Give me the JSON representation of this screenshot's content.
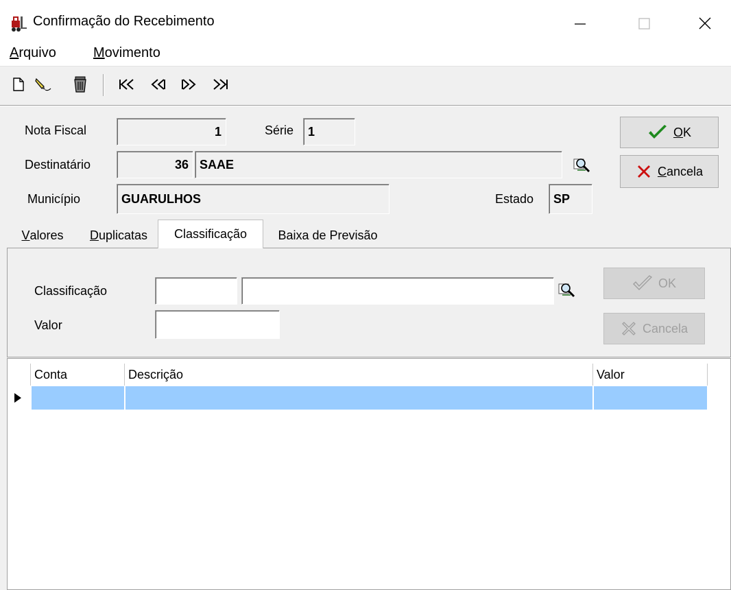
{
  "window": {
    "title": "Confirmação do Recebimento",
    "icon": "forklift-icon",
    "controls": {
      "minimize": "—",
      "maximize": "☐",
      "close": "✕"
    }
  },
  "menu": {
    "items": [
      {
        "label_first": "A",
        "label_rest": "rquivo"
      },
      {
        "label_first": "M",
        "label_rest": "ovimento"
      }
    ]
  },
  "toolbar": {
    "icons": [
      "new-document-icon",
      "edit-pencil-icon",
      "delete-trash-icon",
      "first-record-icon",
      "previous-record-icon",
      "next-record-icon",
      "last-record-icon"
    ]
  },
  "header": {
    "nota_fiscal_label": "Nota Fiscal",
    "nota_fiscal_value": "1",
    "serie_label": "Série",
    "serie_value": "1",
    "destinatario_label": "Destinatário",
    "destinatario_code": "36",
    "destinatario_name": "SAAE",
    "municipio_label": "Município",
    "municipio_value": "GUARULHOS",
    "estado_label": "Estado",
    "estado_value": "SP",
    "ok_first": "O",
    "ok_rest": "K",
    "cancel_first": "C",
    "cancel_rest": "ancela"
  },
  "tabs": [
    {
      "first": "V",
      "rest": "alores"
    },
    {
      "first": "D",
      "rest": "uplicatas"
    },
    {
      "first": "",
      "rest": "Classificação"
    },
    {
      "first": "",
      "rest": "Baixa de Previsão"
    }
  ],
  "classificacao": {
    "classificacao_label": "Classificação",
    "valor_label": "Valor",
    "code_value": "",
    "desc_value": "",
    "valor_value": "",
    "ok_label": "OK",
    "cancel_label": "Cancela"
  },
  "grid": {
    "columns": [
      "Conta",
      "Descrição",
      "Valor"
    ],
    "rows": [
      {
        "conta": "",
        "descricao": "",
        "valor": ""
      }
    ]
  },
  "colors": {
    "selected_row": "#99ccff",
    "ok_check": "#1e8a1e",
    "cancel_x": "#cc1010"
  }
}
